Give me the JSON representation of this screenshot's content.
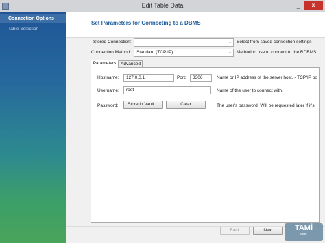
{
  "window": {
    "title": "Edit Table Data",
    "close_symbol": "x",
    "minimize_symbol": "_"
  },
  "sidebar": {
    "items": [
      {
        "label": "Connection Options",
        "active": true
      },
      {
        "label": "Table Selection",
        "active": false
      }
    ]
  },
  "header": {
    "title": "Set Parameters for Connecting to a DBMS"
  },
  "connection": {
    "stored_label": "Stored Connection:",
    "stored_value": "",
    "stored_hint": "Select from saved connection settings",
    "method_label": "Connection Method:",
    "method_value": "Standard (TCP/IP)",
    "method_hint": "Method to use to connect to the RDBMS",
    "dropdown_arrow": "⌄"
  },
  "tabs": [
    {
      "label": "Parameters",
      "active": true
    },
    {
      "label": "Advanced",
      "active": false
    }
  ],
  "params": {
    "hostname_label": "Hostname:",
    "hostname_value": "127.0.0.1",
    "port_label": "Port:",
    "port_value": "3306",
    "hostname_hint": "Name or IP address of the server host. - TCP/IP po",
    "username_label": "Username:",
    "username_value": "root",
    "username_hint": "Name of the user to connect with.",
    "password_label": "Password:",
    "store_vault_label": "Store in Vault ...",
    "clear_label": "Clear",
    "password_hint": "The user's password. Will be requested later if it's"
  },
  "footer": {
    "back_label": "Back",
    "next_label": "Next"
  },
  "watermark": {
    "text": "TAMİ",
    "sub": "indir"
  },
  "colors": {
    "accent": "#1f5f9e",
    "close": "#c7322c",
    "sidebar_top": "#1f5597",
    "sidebar_bottom": "#4aa45a"
  }
}
